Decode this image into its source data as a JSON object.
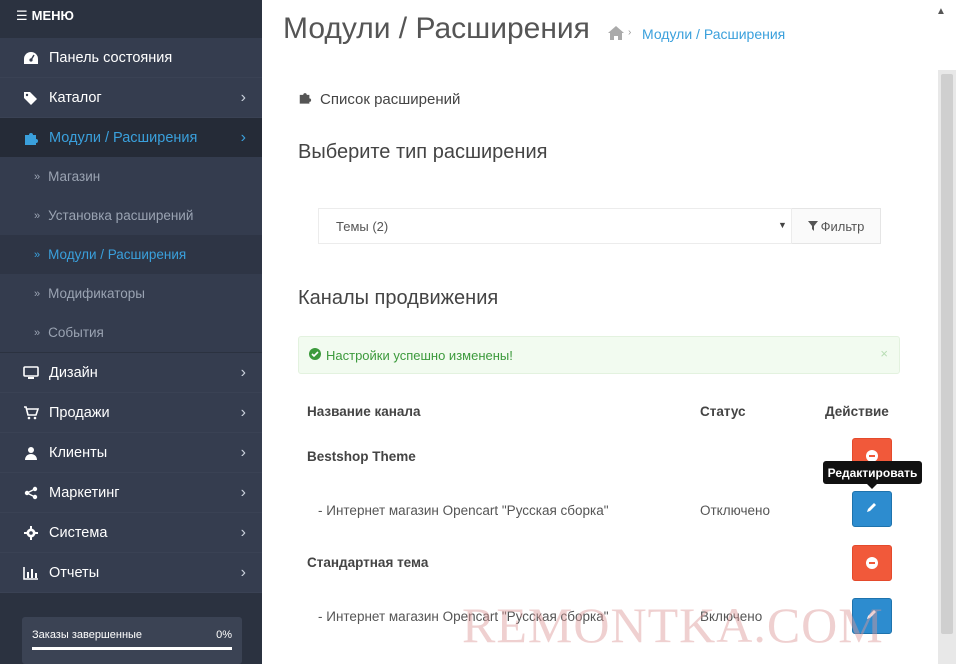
{
  "menu": {
    "title": "МЕНЮ"
  },
  "sidebar": {
    "items": [
      {
        "label": "Панель состояния",
        "icon": "dashboard-icon",
        "has_children": false
      },
      {
        "label": "Каталог",
        "icon": "tags-icon",
        "has_children": true
      },
      {
        "label": "Модули / Расширения",
        "icon": "puzzle-icon",
        "has_children": true,
        "active": true
      },
      {
        "label": "Дизайн",
        "icon": "desktop-icon",
        "has_children": true
      },
      {
        "label": "Продажи",
        "icon": "cart-icon",
        "has_children": true
      },
      {
        "label": "Клиенты",
        "icon": "user-icon",
        "has_children": true
      },
      {
        "label": "Маркетинг",
        "icon": "share-icon",
        "has_children": true
      },
      {
        "label": "Система",
        "icon": "gear-icon",
        "has_children": true
      },
      {
        "label": "Отчеты",
        "icon": "bar-chart-icon",
        "has_children": true
      }
    ],
    "submenu": [
      {
        "label": "Магазин"
      },
      {
        "label": "Установка расширений"
      },
      {
        "label": "Модули / Расширения",
        "current": true
      },
      {
        "label": "Модификаторы"
      },
      {
        "label": "События"
      }
    ],
    "progress": {
      "label": "Заказы завершенные",
      "value_text": "0%",
      "fraction": 0.0
    }
  },
  "header": {
    "title": "Модули / Расширения",
    "breadcrumb": "Модули / Расширения"
  },
  "panel": {
    "title": "Список расширений",
    "type_heading": "Выберите тип расширения",
    "select_value": "Темы (2)",
    "filter_label": "Фильтр",
    "section_heading": "Каналы продвижения",
    "alert_text": "Настройки успешно изменены!",
    "alert_close": "×"
  },
  "table": {
    "columns": [
      "Название канала",
      "Статус",
      "Действие"
    ],
    "groups": [
      {
        "name": "Bestshop Theme",
        "extension": "-   Интернет магазин Opencart \"Русская сборка\"",
        "status": "Отключено"
      },
      {
        "name": "Стандартная тема",
        "extension": "-   Интернет магазин Opencart \"Русская сборка\"",
        "status": "Включено"
      }
    ]
  },
  "tooltip": "Редактировать",
  "watermark": "REMONTKA.COM",
  "colors": {
    "accent": "#3aa0dc",
    "sidebar": "#2b3240",
    "danger": "#f1593a",
    "primary": "#2d8ccf",
    "success": "#3c9a3c"
  }
}
